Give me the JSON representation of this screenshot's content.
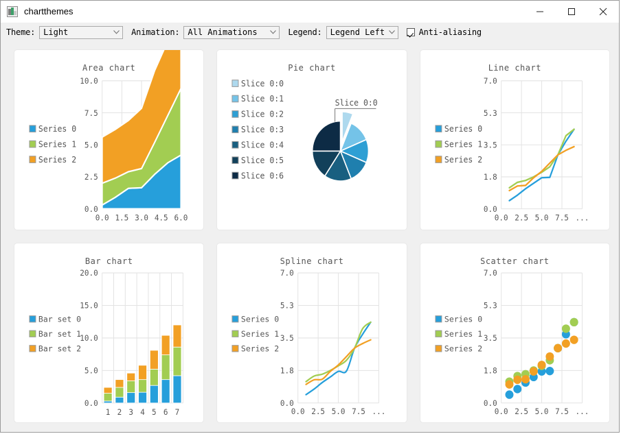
{
  "window": {
    "title": "chartthemes",
    "icon": "chart-app-icon",
    "controls": {
      "minimize": "minimize-icon",
      "maximize": "maximize-icon",
      "close": "close-icon"
    }
  },
  "toolbar": {
    "theme_label": "Theme:",
    "theme_value": "Light",
    "animation_label": "Animation:",
    "animation_value": "All Animations",
    "legend_label": "Legend:",
    "legend_value": "Legend Left",
    "antialiasing_label": "Anti-aliasing",
    "antialiasing_checked": true
  },
  "palette": {
    "series0": "#269fdb",
    "series1": "#a2cd52",
    "series2": "#f2a024",
    "pie": [
      "#aed9ee",
      "#74c3e8",
      "#2e9fd4",
      "#1f7fae",
      "#195f80",
      "#12405a",
      "#0d2b45"
    ],
    "grid": "#e3e3e3",
    "text": "#555555",
    "card_bg": "#ffffff",
    "app_bg": "#f0f0f0"
  },
  "chart_data": [
    {
      "id": "area",
      "type": "area",
      "title": "Area chart",
      "legend_position": "left",
      "legend": [
        "Series 0",
        "Series 1",
        "Series 2"
      ],
      "stacked": true,
      "x": [
        0,
        1,
        2,
        3,
        4,
        5,
        6
      ],
      "xlim": [
        0,
        6
      ],
      "ylim": [
        0,
        10
      ],
      "xticks": [
        "0.0",
        "1.5",
        "3.0",
        "4.5",
        "6.0"
      ],
      "yticks": [
        "0.0",
        "2.5",
        "5.0",
        "7.5",
        "10.0"
      ],
      "series": [
        {
          "name": "Series 0",
          "values": [
            0.3,
            0.9,
            1.6,
            1.65,
            2.7,
            3.6,
            4.2
          ]
        },
        {
          "name": "Series 1",
          "values": [
            1.7,
            1.5,
            1.3,
            1.5,
            2.5,
            3.7,
            5.2
          ]
        },
        {
          "name": "Series 2",
          "values": [
            3.6,
            3.8,
            4.0,
            4.7,
            5.6,
            5.8,
            6.1
          ]
        }
      ]
    },
    {
      "id": "pie",
      "type": "pie",
      "title": "Pie chart",
      "legend_position": "left",
      "legend": [
        "Slice 0:0",
        "Slice 0:1",
        "Slice 0:2",
        "Slice 0:3",
        "Slice 0:4",
        "Slice 0:5",
        "Slice 0:6"
      ],
      "callout_label": "Slice 0:0",
      "exploded_index": 0,
      "slices": [
        {
          "label": "Slice 0:0",
          "value": 1
        },
        {
          "label": "Slice 0:1",
          "value": 2
        },
        {
          "label": "Slice 0:2",
          "value": 2
        },
        {
          "label": "Slice 0:3",
          "value": 2
        },
        {
          "label": "Slice 0:4",
          "value": 2.5
        },
        {
          "label": "Slice 0:5",
          "value": 2.5
        },
        {
          "label": "Slice 0:6",
          "value": 4
        }
      ]
    },
    {
      "id": "line",
      "type": "line",
      "title": "Line chart",
      "legend_position": "left",
      "legend": [
        "Series 0",
        "Series 1",
        "Series 2"
      ],
      "x": [
        1,
        2,
        3,
        4,
        5,
        6,
        7,
        8,
        9
      ],
      "xlim": [
        0,
        10
      ],
      "ylim": [
        0,
        7
      ],
      "xticks": [
        "0.0",
        "2.5",
        "5.0",
        "7.5",
        "..."
      ],
      "yticks": [
        "0.0",
        "1.8",
        "3.5",
        "5.3",
        "7.0"
      ],
      "series": [
        {
          "name": "Series 0",
          "values": [
            0.45,
            0.75,
            1.1,
            1.4,
            1.7,
            1.72,
            2.95,
            3.7,
            4.35
          ]
        },
        {
          "name": "Series 1",
          "values": [
            1.15,
            1.45,
            1.55,
            1.75,
            2.0,
            2.3,
            2.95,
            4.0,
            4.35
          ]
        },
        {
          "name": "Series 2",
          "values": [
            1.0,
            1.25,
            1.28,
            1.7,
            2.05,
            2.5,
            2.95,
            3.2,
            3.4
          ]
        }
      ]
    },
    {
      "id": "bar",
      "type": "bar",
      "title": "Bar chart",
      "legend_position": "left",
      "legend": [
        "Bar set 0",
        "Bar set 1",
        "Bar set 2"
      ],
      "stacked": true,
      "categories": [
        "1",
        "2",
        "3",
        "4",
        "5",
        "6",
        "7"
      ],
      "xlim": [
        0,
        7
      ],
      "ylim": [
        0,
        20
      ],
      "yticks": [
        "0.0",
        "5.0",
        "10.0",
        "15.0",
        "20.0"
      ],
      "series": [
        {
          "name": "Bar set 0",
          "values": [
            0.3,
            0.9,
            1.6,
            1.65,
            2.7,
            3.6,
            4.2
          ]
        },
        {
          "name": "Bar set 1",
          "values": [
            1.2,
            1.5,
            1.8,
            1.95,
            2.5,
            3.8,
            4.4
          ]
        },
        {
          "name": "Bar set 2",
          "values": [
            0.9,
            1.2,
            1.2,
            2.2,
            2.9,
            3.0,
            3.4
          ]
        }
      ]
    },
    {
      "id": "spline",
      "type": "line",
      "title": "Spline chart",
      "legend_position": "left",
      "legend": [
        "Series 0",
        "Series 1",
        "Series 2"
      ],
      "x": [
        1,
        2,
        3,
        4,
        5,
        6,
        7,
        8,
        9
      ],
      "xlim": [
        0,
        10
      ],
      "ylim": [
        0,
        7
      ],
      "xticks": [
        "0.0",
        "2.5",
        "5.0",
        "7.5",
        "..."
      ],
      "yticks": [
        "0.0",
        "1.8",
        "3.5",
        "5.3",
        "7.0"
      ],
      "smooth": true,
      "series": [
        {
          "name": "Series 0",
          "values": [
            0.45,
            0.75,
            1.1,
            1.4,
            1.7,
            1.72,
            2.95,
            3.7,
            4.35
          ]
        },
        {
          "name": "Series 1",
          "values": [
            1.15,
            1.45,
            1.55,
            1.75,
            2.0,
            2.3,
            2.95,
            4.0,
            4.35
          ]
        },
        {
          "name": "Series 2",
          "values": [
            1.0,
            1.25,
            1.28,
            1.7,
            2.05,
            2.5,
            2.95,
            3.2,
            3.4
          ]
        }
      ]
    },
    {
      "id": "scatter",
      "type": "scatter",
      "title": "Scatter chart",
      "legend_position": "left",
      "legend": [
        "Series 0",
        "Series 1",
        "Series 2"
      ],
      "x": [
        1,
        2,
        3,
        4,
        5,
        6,
        7,
        8,
        9
      ],
      "xlim": [
        0,
        10
      ],
      "ylim": [
        0,
        7
      ],
      "xticks": [
        "0.0",
        "2.5",
        "5.0",
        "7.5",
        "..."
      ],
      "yticks": [
        "0.0",
        "1.8",
        "3.5",
        "5.3",
        "7.0"
      ],
      "series": [
        {
          "name": "Series 0",
          "values": [
            0.45,
            0.75,
            1.1,
            1.4,
            1.7,
            1.72,
            2.95,
            3.7,
            4.35
          ]
        },
        {
          "name": "Series 1",
          "values": [
            1.15,
            1.45,
            1.55,
            1.75,
            2.0,
            2.3,
            2.95,
            4.0,
            4.35
          ]
        },
        {
          "name": "Series 2",
          "values": [
            1.0,
            1.25,
            1.28,
            1.7,
            2.05,
            2.5,
            2.95,
            3.2,
            3.4
          ]
        }
      ]
    }
  ]
}
